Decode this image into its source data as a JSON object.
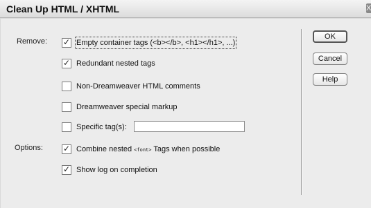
{
  "window": {
    "title": "Clean Up HTML / XHTML",
    "close_glyph": "X"
  },
  "labels": {
    "remove": "Remove:",
    "options": "Options:"
  },
  "remove_options": [
    {
      "label": "Empty container tags (<b></b>, <h1></h1>, ...)",
      "checked": true
    },
    {
      "label": "Redundant nested tags",
      "checked": true
    },
    {
      "label": "Non-Dreamweaver HTML comments",
      "checked": false
    },
    {
      "label": "Dreamweaver special markup",
      "checked": false
    },
    {
      "label": "Specific tag(s):",
      "checked": false
    }
  ],
  "specific_tags_value": "",
  "options": [
    {
      "label_before": "Combine nested",
      "label_tag": "<font>",
      "label_after": "Tags when possible",
      "checked": true
    },
    {
      "label": "Show log on completion",
      "checked": true
    }
  ],
  "buttons": {
    "ok": "OK",
    "cancel": "Cancel",
    "help": "Help"
  },
  "check_glyph": "✓"
}
